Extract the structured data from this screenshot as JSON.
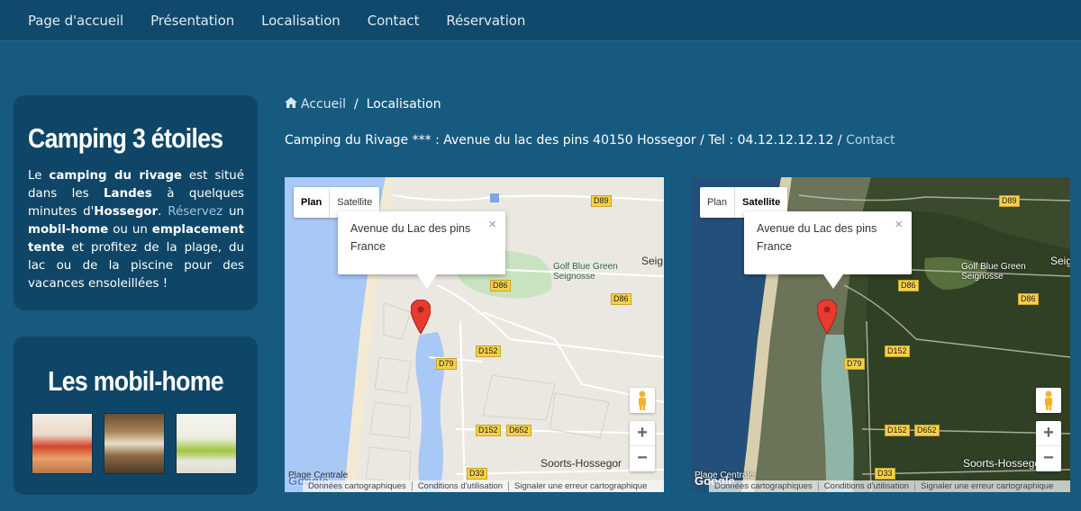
{
  "nav": {
    "items": [
      "Page d'accueil",
      "Présentation",
      "Localisation",
      "Contact",
      "Réservation"
    ]
  },
  "sidebar": {
    "camping": {
      "title": "Camping 3 étoiles",
      "text": {
        "t1": "Le ",
        "b1": "camping du rivage",
        "t2": " est situé dans les ",
        "b2": "Landes",
        "t3": " à quelques minutes d'",
        "b3": "Hossegor",
        "t4": ". ",
        "l1": "Réservez",
        "t5": " un ",
        "b4": "mobil-home",
        "t6": " ou un ",
        "b5": "emplacement tente",
        "t7": " et profitez de la plage, du lac ou de la piscine pour des vacances ensoleillées !"
      }
    },
    "mobilhome": {
      "title": "Les mobil-home"
    }
  },
  "breadcrumb": {
    "home": "Accueil",
    "separator": "/",
    "current": "Localisation"
  },
  "address": {
    "text": "Camping du Rivage *** : Avenue du lac des pins 40150 Hossegor / Tel : 04.12.12.12.12 / ",
    "link": "Contact"
  },
  "map": {
    "type_plan": "Plan",
    "type_satellite": "Satellite",
    "info_line1": "Avenue du Lac des pins",
    "info_line2": "France",
    "close": "×",
    "zoom_in": "+",
    "zoom_out": "−",
    "footer": [
      "Données cartographiques",
      "Conditions d'utilisation",
      "Signaler une erreur cartographique"
    ],
    "google": "Google",
    "roads": [
      "D89",
      "D86",
      "D86",
      "D152",
      "D79",
      "D152",
      "D652",
      "D33"
    ],
    "golf_1": "Golf Blue Green",
    "golf_2": "Seignosse",
    "town_seig": "Seig",
    "town_soorts": "Soorts-Hossegor",
    "plage": "Plage Centrale"
  },
  "colors": {
    "page_bg": "#175a80",
    "nav_bg": "#10496b",
    "panel_bg": "#0f4667"
  }
}
